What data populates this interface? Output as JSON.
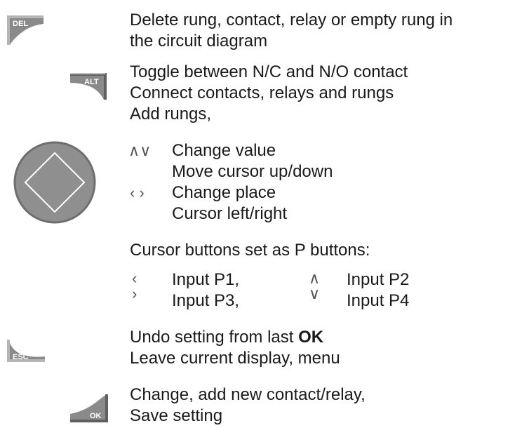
{
  "del": {
    "key_label": "DEL",
    "line1": "Delete rung, contact, relay or empty rung in",
    "line2": "the circuit diagram"
  },
  "alt": {
    "key_label": "ALT",
    "line1": "Toggle between N/C and N/O contact",
    "line2": "Connect contacts, relays and rungs",
    "line3": "Add rungs,"
  },
  "cursor": {
    "updown_glyph": "∧∨",
    "line1": "Change value",
    "line2": "Move cursor up/down",
    "leftright_glyph": "‹ ›",
    "line3": "Change place",
    "line4": "Cursor left/right"
  },
  "p_buttons": {
    "heading": "Cursor buttons set as P buttons:",
    "items": [
      {
        "glyph": "‹",
        "label": "Input P1,"
      },
      {
        "glyph": "∧",
        "label": "Input P2"
      },
      {
        "glyph": "›",
        "label": "Input P3,"
      },
      {
        "glyph": "∨",
        "label": "Input P4"
      }
    ]
  },
  "esc": {
    "key_label": "ESC",
    "line1_prefix": "Undo setting from last ",
    "line1_bold": "OK",
    "line2": "Leave current display, menu"
  },
  "ok": {
    "key_label": "OK",
    "line1": "Change, add new contact/relay,",
    "line2": "Save setting"
  }
}
